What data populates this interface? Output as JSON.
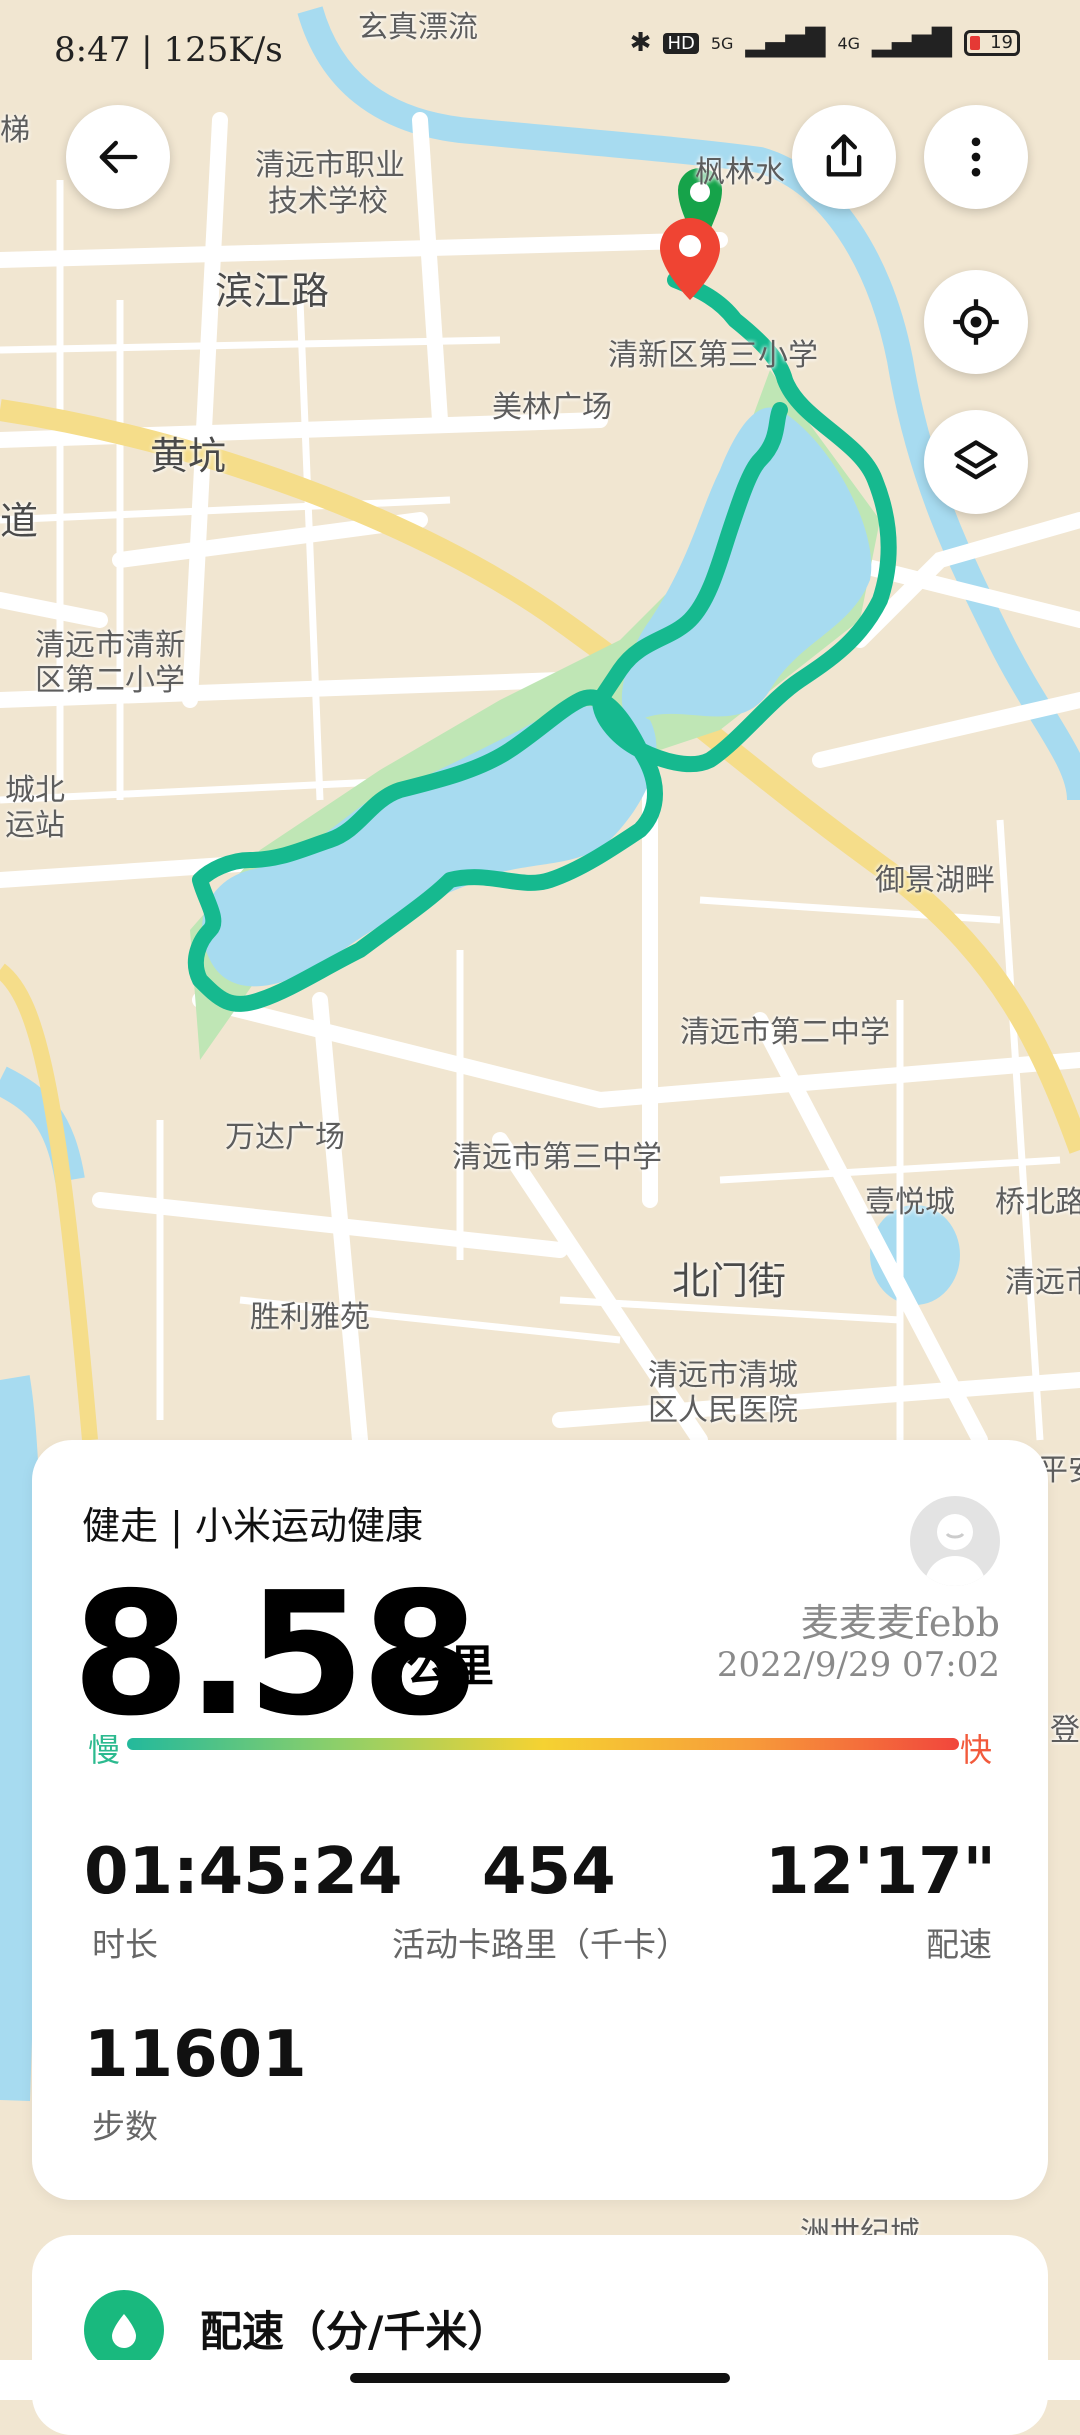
{
  "status_bar": {
    "time": "8:47",
    "net_speed": "125K/s",
    "battery": "19",
    "signal_labels": [
      "5G",
      "4G"
    ],
    "hd_label": "HD"
  },
  "map": {
    "labels": [
      {
        "text": "玄真漂流"
      },
      {
        "text": "清远市职业"
      },
      {
        "text": "技术学校"
      },
      {
        "text": "滨江路"
      },
      {
        "text": "黄坑"
      },
      {
        "text": "美林广场"
      },
      {
        "text": "清新区第三小学"
      },
      {
        "text": "枫林水"
      },
      {
        "text": "清远市清新"
      },
      {
        "text": "区第二小学"
      },
      {
        "text": "城北"
      },
      {
        "text": "运站"
      },
      {
        "text": "道"
      },
      {
        "text": "御景湖畔"
      },
      {
        "text": "清远市第二中学"
      },
      {
        "text": "万达广场"
      },
      {
        "text": "清远市第三中学"
      },
      {
        "text": "壹悦城"
      },
      {
        "text": "桥北路"
      },
      {
        "text": "北门街"
      },
      {
        "text": "胜利雅苑"
      },
      {
        "text": "清远市"
      },
      {
        "text": "清远市清城"
      },
      {
        "text": "区人民医院"
      },
      {
        "text": "梯"
      },
      {
        "text": "平安"
      },
      {
        "text": "登"
      },
      {
        "text": "洲世纪城"
      }
    ],
    "route_color": "#16b98f",
    "water_color": "#a7dbf0"
  },
  "buttons": {
    "back": "back-arrow-icon",
    "share": "share-icon",
    "more": "more-vertical-icon",
    "locate": "locate-icon",
    "layers": "layers-icon"
  },
  "workout": {
    "title": "健走 | 小米运动健康",
    "distance": "8.58",
    "distance_unit": "公里",
    "username": "麦麦麦febb",
    "datetime": "2022/9/29 07:02",
    "slow_label": "慢",
    "fast_label": "快",
    "stats": [
      {
        "value": "01:45:24",
        "label": "时长"
      },
      {
        "value": "454",
        "label": "活动卡路里（千卡）"
      },
      {
        "value": "12'17\"",
        "label": "配速"
      },
      {
        "value": "11601",
        "label": "步数"
      }
    ]
  },
  "pace_section": {
    "title": "配速（分/千米）"
  }
}
